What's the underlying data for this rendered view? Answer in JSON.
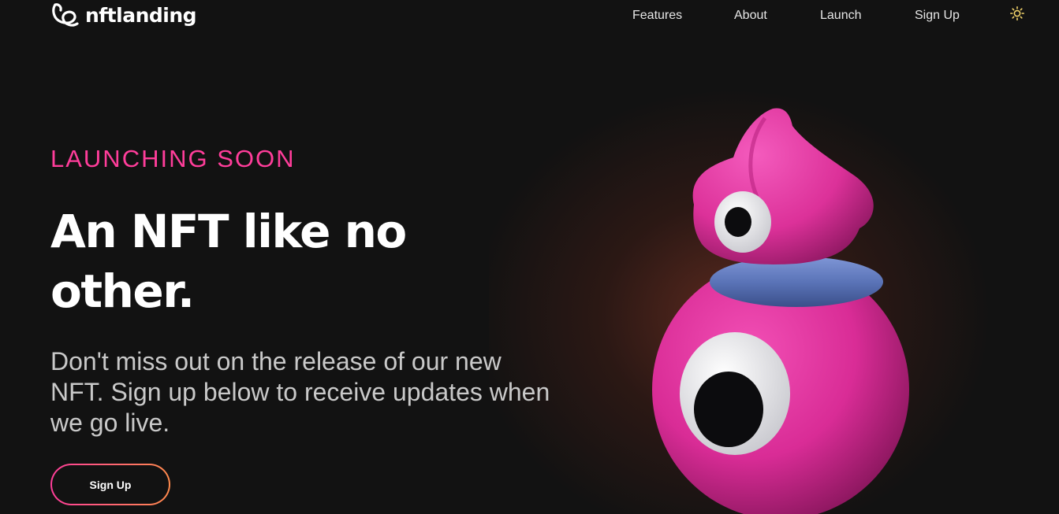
{
  "brand": {
    "name": "nftlanding",
    "icon": "swirl-logo-icon"
  },
  "nav": {
    "items": [
      {
        "label": "Features"
      },
      {
        "label": "About"
      },
      {
        "label": "Launch"
      },
      {
        "label": "Sign Up"
      }
    ],
    "theme_toggle_icon": "sun-icon"
  },
  "hero": {
    "eyebrow": "LAUNCHING SOON",
    "headline": "An NFT like no other.",
    "subtext": "Don't miss out on the release of our new NFT. Sign up below to receive updates when we go live.",
    "cta_label": "Sign Up"
  },
  "colors": {
    "accent_pink": "#ff3d9a",
    "accent_orange": "#ff8a4c",
    "background": "#121212",
    "character_pink": "#e0339e",
    "character_ring": "#5b74b8"
  }
}
